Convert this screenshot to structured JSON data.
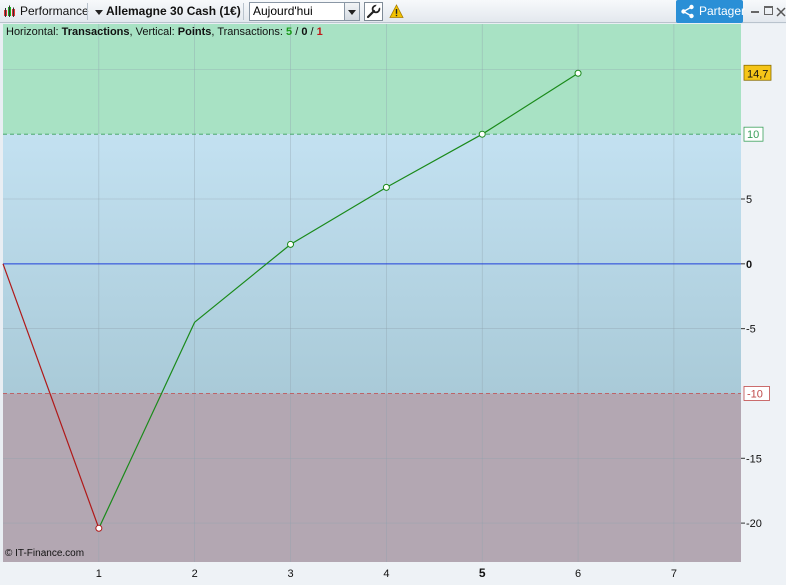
{
  "toolbar": {
    "performance_label": "Performance",
    "instrument_label": "Allemagne 30 Cash (1€)",
    "period_value": "Aujourd'hui",
    "share_label": "Partager"
  },
  "header": {
    "prefix": "Horizontal: ",
    "horizontal_value": "Transactions",
    "vertical_prefix": ", Vertical: ",
    "vertical_value": "Points",
    "trans_prefix": ", Transactions: ",
    "trans_win": "5",
    "slash1": " / ",
    "trans_neutral": "0",
    "slash2": " / ",
    "trans_loss": "1"
  },
  "credit": "© IT-Finance.com",
  "colors": {
    "upper_zone": "#a8e2c4",
    "middle_zone_top": "#c3e1f1",
    "middle_zone_bottom": "#a9cad8",
    "lower_zone": "#b3a7b2",
    "gain_line": "#1a8a1a",
    "loss_line": "#b01818",
    "zero_line": "#1f3fd9",
    "last_value_badge": "#f5c518"
  },
  "chart_data": {
    "type": "line",
    "xlabel": "",
    "ylabel": "",
    "xlim": [
      0,
      7.7
    ],
    "ylim": [
      -23,
      18.5
    ],
    "x_ticks": [
      "1",
      "2",
      "3",
      "4",
      "5",
      "6",
      "7"
    ],
    "y_ticks": [
      "-20",
      "-15",
      "-5",
      "0",
      "5"
    ],
    "bold_x_tick": "5",
    "zone_thresholds": {
      "upper": 10,
      "lower": -10
    },
    "threshold_labels": [
      "10",
      "-10"
    ],
    "last_value_label": "14,7",
    "zero_line": 0,
    "points": [
      {
        "x": 0,
        "y": 0
      },
      {
        "x": 1,
        "y": -20.4
      },
      {
        "x": 2,
        "y": -4.5
      },
      {
        "x": 3,
        "y": 1.5
      },
      {
        "x": 4,
        "y": 5.9
      },
      {
        "x": 5,
        "y": 10.0
      },
      {
        "x": 6,
        "y": 14.7
      }
    ],
    "marked_points": [
      1,
      3,
      4,
      5,
      6
    ]
  }
}
